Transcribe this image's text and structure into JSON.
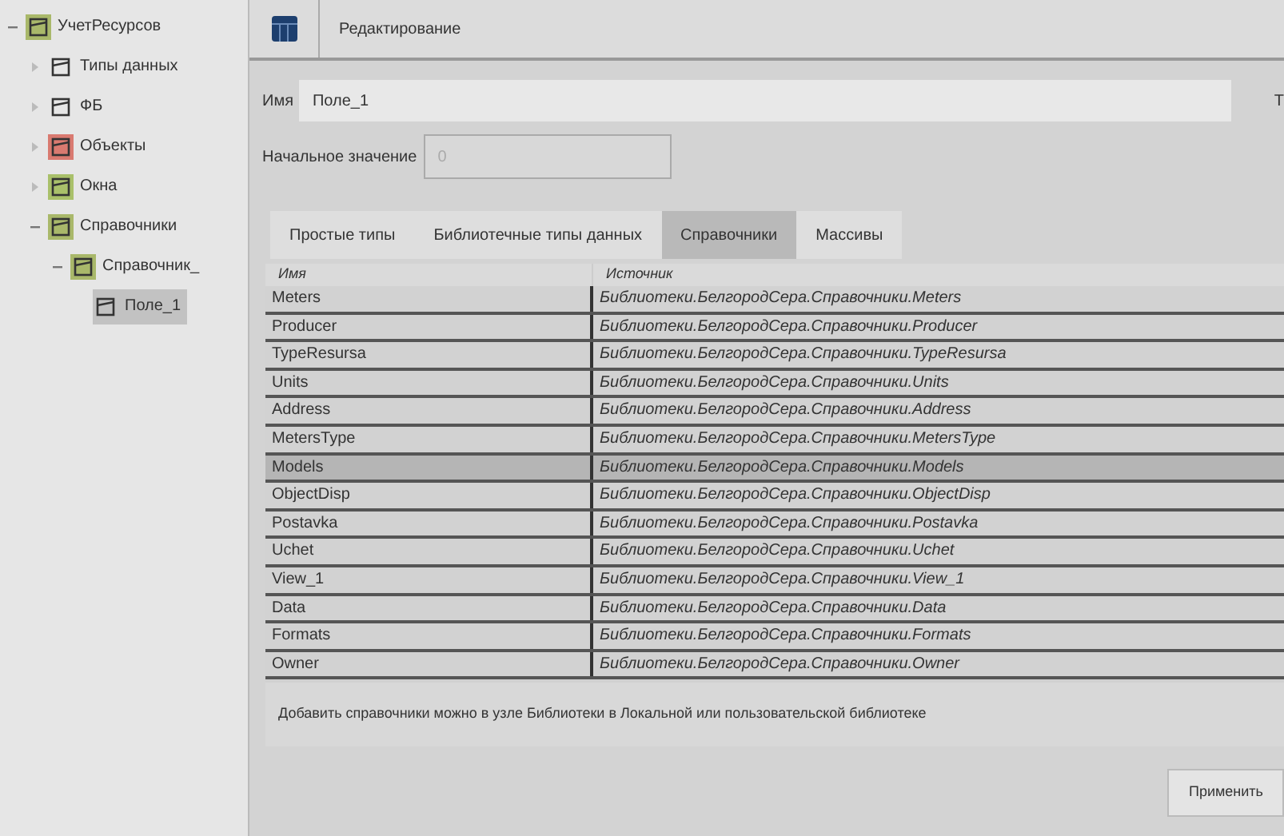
{
  "tree": [
    {
      "label": "УчетРесурсов",
      "kind": "root",
      "expanded": true,
      "selected": false,
      "children": [
        {
          "label": "Типы данных",
          "kind": "folder",
          "expanded": false,
          "selected": false
        },
        {
          "label": "ФБ",
          "kind": "folder",
          "expanded": false,
          "selected": false
        },
        {
          "label": "Объекты",
          "kind": "objects",
          "expanded": false,
          "selected": false
        },
        {
          "label": "Окна",
          "kind": "windows",
          "expanded": false,
          "selected": false
        },
        {
          "label": "Справочники",
          "kind": "refs",
          "expanded": true,
          "selected": false,
          "children": [
            {
              "label": "Справочник_",
              "kind": "ref",
              "expanded": true,
              "selected": false,
              "children": [
                {
                  "label": "Поле_1",
                  "kind": "field",
                  "selected": true
                }
              ]
            }
          ]
        }
      ]
    }
  ],
  "header": {
    "title": "Редактирование"
  },
  "form": {
    "name_label": "Имя",
    "name_value": "Поле_1",
    "side_label": "Т",
    "initial_label": "Начальное значение",
    "initial_value": "0"
  },
  "tabs": [
    {
      "label": "Простые типы",
      "selected": false
    },
    {
      "label": "Библиотечные типы данных",
      "selected": false
    },
    {
      "label": "Справочники",
      "selected": true
    },
    {
      "label": "Массивы",
      "selected": false
    }
  ],
  "table": {
    "columns": [
      "Имя",
      "Источник"
    ],
    "rows": [
      {
        "name": "Meters",
        "source": "Библиотеки.БелгородСера.Справочники.Meters",
        "selected": false
      },
      {
        "name": "Producer",
        "source": "Библиотеки.БелгородСера.Справочники.Producer",
        "selected": false
      },
      {
        "name": "TypeResursa",
        "source": "Библиотеки.БелгородСера.Справочники.TypeResursa",
        "selected": false
      },
      {
        "name": "Units",
        "source": "Библиотеки.БелгородСера.Справочники.Units",
        "selected": false
      },
      {
        "name": "Address",
        "source": "Библиотеки.БелгородСера.Справочники.Address",
        "selected": false
      },
      {
        "name": "MetersType",
        "source": "Библиотеки.БелгородСера.Справочники.MetersType",
        "selected": false
      },
      {
        "name": "Models",
        "source": "Библиотеки.БелгородСера.Справочники.Models",
        "selected": true
      },
      {
        "name": "ObjectDisp",
        "source": "Библиотеки.БелгородСера.Справочники.ObjectDisp",
        "selected": false
      },
      {
        "name": "Postavka",
        "source": "Библиотеки.БелгородСера.Справочники.Postavka",
        "selected": false
      },
      {
        "name": "Uchet",
        "source": "Библиотеки.БелгородСера.Справочники.Uchet",
        "selected": false
      },
      {
        "name": "View_1",
        "source": "Библиотеки.БелгородСера.Справочники.View_1",
        "selected": false
      },
      {
        "name": "Data",
        "source": "Библиотеки.БелгородСера.Справочники.Data",
        "selected": false
      },
      {
        "name": "Formats",
        "source": "Библиотеки.БелгородСера.Справочники.Formats",
        "selected": false
      },
      {
        "name": "Owner",
        "source": "Библиотеки.БелгородСера.Справочники.Owner",
        "selected": false
      }
    ]
  },
  "hint": "Добавить справочники можно в узле Библиотеки в Локальной или пользовательской библиотеке",
  "apply_button": "Применить"
}
